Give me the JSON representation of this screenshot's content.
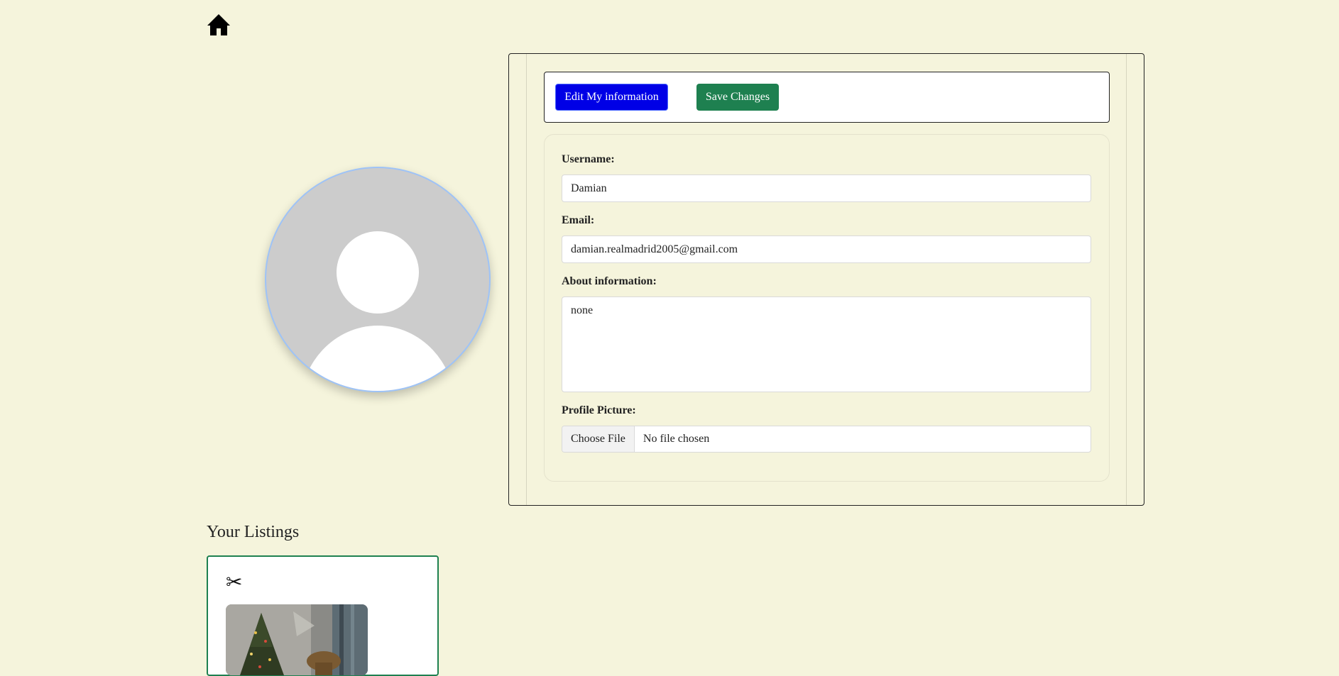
{
  "nav": {
    "home_icon": "home-icon"
  },
  "profile": {
    "avatar_icon": "default-avatar-icon",
    "actions": {
      "edit_label": "Edit My information",
      "save_label": "Save Changes"
    },
    "form": {
      "username": {
        "label": "Username:",
        "value": "Damian"
      },
      "email": {
        "label": "Email:",
        "value": "damian.realmadrid2005@gmail.com"
      },
      "about": {
        "label": "About information:",
        "value": "none"
      },
      "picture": {
        "label": "Profile Picture:",
        "button_label": "Choose File",
        "status": "No file chosen"
      }
    }
  },
  "listings": {
    "title": "Your Listings",
    "items": [
      {
        "remove_icon": "scissors-icon",
        "remove_glyph": "✂",
        "image_icon": "listing-photo-christmas-tree"
      }
    ]
  },
  "colors": {
    "background": "#f5f4dc",
    "edit_button": "#0000e6",
    "save_button": "#1e8050",
    "listing_border": "#1e8050",
    "avatar_border": "#9ec3f7"
  }
}
